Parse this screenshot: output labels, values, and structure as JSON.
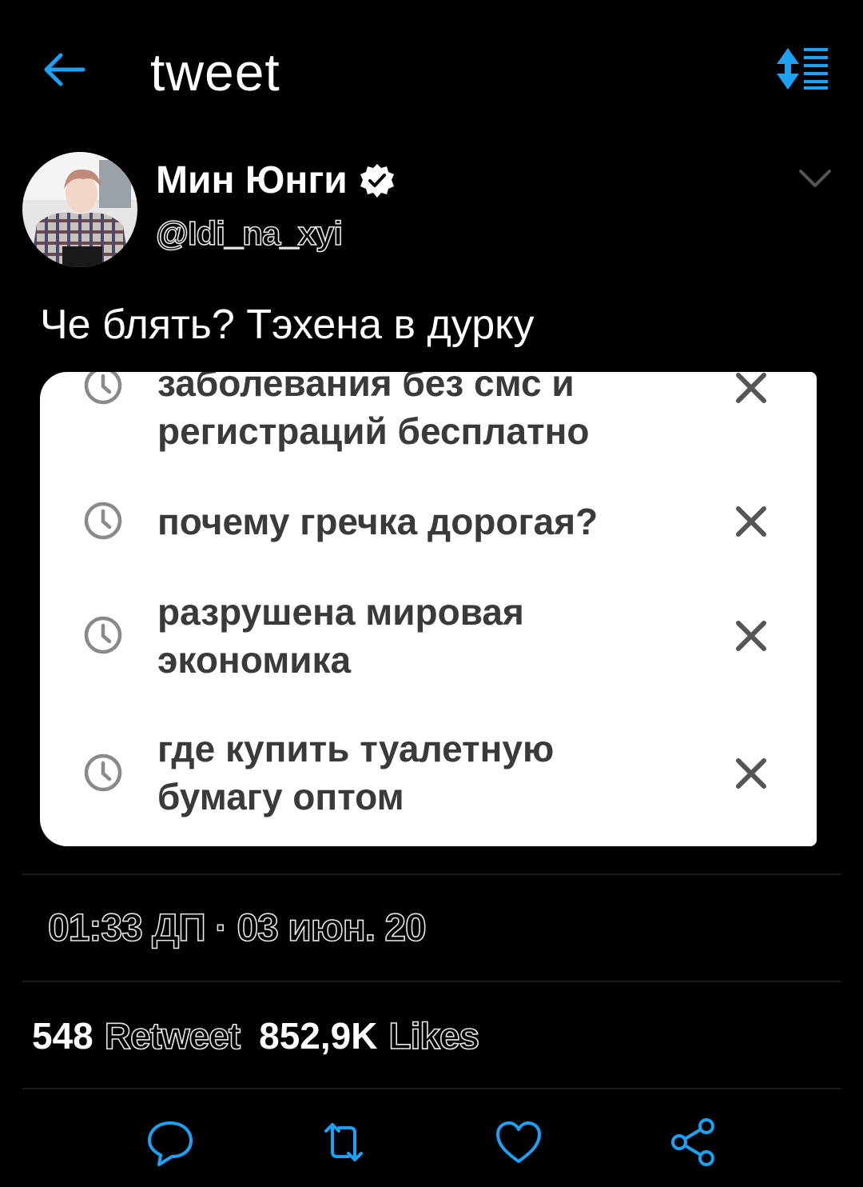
{
  "header": {
    "title": "tweet",
    "back_icon": "arrow-left-icon",
    "sort_icon": "sort-icon",
    "accent": "#1da1f2"
  },
  "user": {
    "name": "Мин Юнги",
    "handle": "@Idi_na_xyi",
    "verified": true
  },
  "tweet": {
    "text": "Че блять? Тэхена в дурку",
    "search_history": [
      {
        "line1": "заболевания без смс и",
        "line2": "регистраций бесплатно"
      },
      {
        "line1": "почему гречка дорогая?",
        "line2": ""
      },
      {
        "line1": "разрушена мировая",
        "line2": "экономика"
      },
      {
        "line1": "где купить туалетную",
        "line2": "бумагу оптом"
      }
    ],
    "time": "01:33 ДП",
    "sep": "·",
    "date": "03 июн. 20",
    "retweets": "548",
    "retweets_label": "Retweet",
    "likes": "852,9K",
    "likes_label": "Likes"
  },
  "actions": [
    "reply-icon",
    "retweet-icon",
    "like-icon",
    "share-icon"
  ],
  "colors": {
    "background": "#000000",
    "icon": "#1da1f2",
    "card": "#ffffff",
    "card_text": "#3a3a3a"
  }
}
